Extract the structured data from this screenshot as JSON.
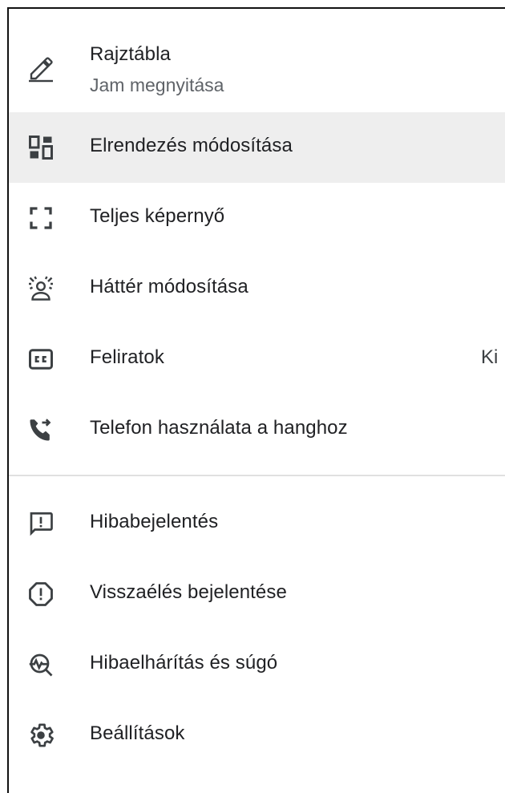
{
  "menu": {
    "items": [
      {
        "icon": "pencil-icon",
        "label": "Rajztábla",
        "sublabel": "Jam megnyitása"
      },
      {
        "icon": "layout-icon",
        "label": "Elrendezés módosítása"
      },
      {
        "icon": "fullscreen-icon",
        "label": "Teljes képernyő"
      },
      {
        "icon": "background-blur-icon",
        "label": "Háttér módosítása"
      },
      {
        "icon": "closed-caption-icon",
        "label": "Feliratok",
        "value": "Ki"
      },
      {
        "icon": "phone-forward-icon",
        "label": "Telefon használata a hanghoz"
      },
      {
        "icon": "feedback-icon",
        "label": "Hibabejelentés"
      },
      {
        "icon": "report-abuse-icon",
        "label": "Visszaélés bejelentése"
      },
      {
        "icon": "troubleshoot-icon",
        "label": "Hibaelhárítás és súgó"
      },
      {
        "icon": "settings-gear-icon",
        "label": "Beállítások"
      }
    ],
    "highlighted_index": 1
  },
  "colors": {
    "text": "#202124",
    "secondary_text": "#5f6368",
    "icon": "#3c4043",
    "highlight_bg": "#eeeeee",
    "divider": "#e0e0e0"
  }
}
